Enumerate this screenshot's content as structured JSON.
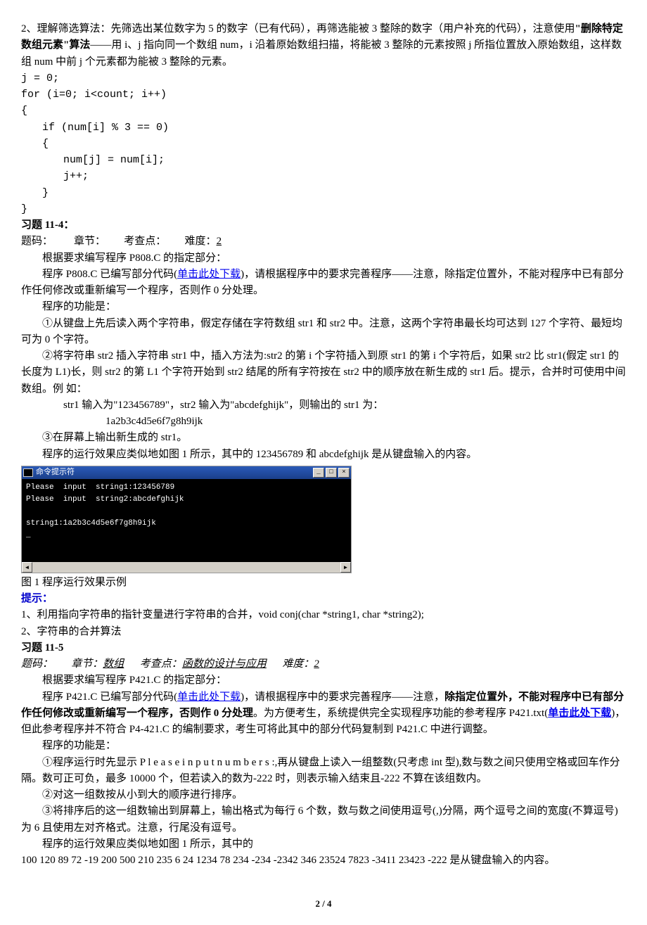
{
  "intro": {
    "part2_lead": "2、理解筛选算法：先筛选出某位数字为 5 的数字（已有代码），再筛选能被 3 整除的数字（用户补充的代码），注意使用",
    "part2_bold": "\"删除特定数组元素\"算法",
    "part2_tail": "——用 i、j 指向同一个数组 num，i 沿着原始数组扫描，将能被 3 整除的元素按照 j 所指位置放入原始数组，这样数组 num 中前 j 个元素都为能被 3 整除的元素。"
  },
  "code": {
    "l1": "j = 0;",
    "l2": "for (i=0; i<count; i++)",
    "l3": "{",
    "l4": "if (num[i] % 3 == 0)",
    "l5": "{",
    "l6": "num[j] = num[i];",
    "l7": "j++;",
    "l8": "}",
    "l9": "}"
  },
  "ex4": {
    "heading": "习题 11-4：",
    "meta_prefix": "题码：",
    "meta_chapter": "章节：",
    "meta_point": "考查点：",
    "meta_diff_label": "难度：",
    "meta_diff_val": "2",
    "p1": "根据要求编写程序 P808.C 的指定部分：",
    "p2a": "程序 P808.C 已编写部分代码(",
    "p2link": "单击此处下载",
    "p2b": ")，请根据程序中的要求完善程序——注意，除指定位置外，不能对程序中已有部分作任何修改或重新编写一个程序，否则作 0 分处理。",
    "p3": "程序的功能是：",
    "p4": "①从键盘上先后读入两个字符串，假定存储在字符数组 str1 和 str2 中。注意，这两个字符串最长均可达到 127 个字符、最短均可为 0 个字符。",
    "p5": "②将字符串 str2 插入字符串 str1 中，插入方法为:str2 的第 i 个字符插入到原 str1 的第 i 个字符后，如果 str2 比 str1(假定 str1 的长度为 L1)长，则 str2 的第 L1 个字符开始到 str2 结尾的所有字符按在 str2 中的顺序放在新生成的 str1 后。提示，合并时可使用中间数组。例 如：",
    "p6": "str1 输入为\"123456789\"，str2 输入为\"abcdefghijk\"，则输出的 str1 为：",
    "p7": "1a2b3c4d5e6f7g8h9ijk",
    "p8": "③在屏幕上输出新生成的 str1。",
    "p9": "程序的运行效果应类似地如图 1 所示，其中的 123456789 和 abcdefghijk 是从键盘输入的内容。"
  },
  "cmd": {
    "title": "命令提示符",
    "min": "_",
    "max": "□",
    "close": "×",
    "body": "Please  input  string1:123456789\nPlease  input  string2:abcdefghijk\n\nstring1:1a2b3c4d5e6f7g8h9ijk\n_",
    "larr": "◄",
    "rarr": "►"
  },
  "fig1": "图 1 程序运行效果示例",
  "hint": {
    "label": "提示：",
    "l1": "1、利用指向字符串的指针变量进行字符串的合并，void conj(char *string1, char *string2);",
    "l2": "2、字符串的合并算法"
  },
  "ex5": {
    "heading": "习题 11-5",
    "meta_prefix": "题码：",
    "meta_chapter_label": "章节：",
    "meta_chapter_val": "数组",
    "meta_point_label": "考查点：",
    "meta_point_val": "函数的设计与应用",
    "meta_diff_label": "难度：",
    "meta_diff_val": "2",
    "p1": "根据要求编写程序 P421.C 的指定部分：",
    "p2a": "程序 P421.C 已编写部分代码(",
    "p2link": "单击此处下载",
    "p2b": ")，请根据程序中的要求完善程序——注意，",
    "p2bold": "除指定位置外，不能对程序中已有部分作任何修改或重新编写一个程序，否则作 0 分处理",
    "p2c": "。为方便考生，系统提供完全实现程序功能的参考程序 P421.txt(",
    "p2link2": "单击此处下载",
    "p2d": ")，但此参考程序并不符合 P4-421.C 的编制要求，考生可将此其中的部分代码复制到 P421.C 中进行调整。",
    "p3": "程序的功能是：",
    "p4": "①程序运行时先显示 P l e a s e   i n p u t   n u m b e r s :,再从键盘上读入一组整数(只考虑 int 型),数与数之间只使用空格或回车作分隔。数可正可负，最多 10000 个，但若读入的数为-222 时，则表示输入结束且-222 不算在该组数内。",
    "p5": "②对这一组数按从小到大的顺序进行排序。",
    "p6": "③将排序后的这一组数输出到屏幕上，输出格式为每行 6 个数，数与数之间使用逗号(,)分隔，两个逗号之间的宽度(不算逗号)为 6 且使用左对齐格式。注意，行尾没有逗号。",
    "p7": "程序的运行效果应类似地如图 1 所示，其中的",
    "p8": "100  120  89  72  -19  200  500  210  235  6  24  1234  78  234  -234  -2342  346  23524  7823  -3411  23423  -222 是从键盘输入的内容。"
  },
  "pagenum": "2 / 4"
}
